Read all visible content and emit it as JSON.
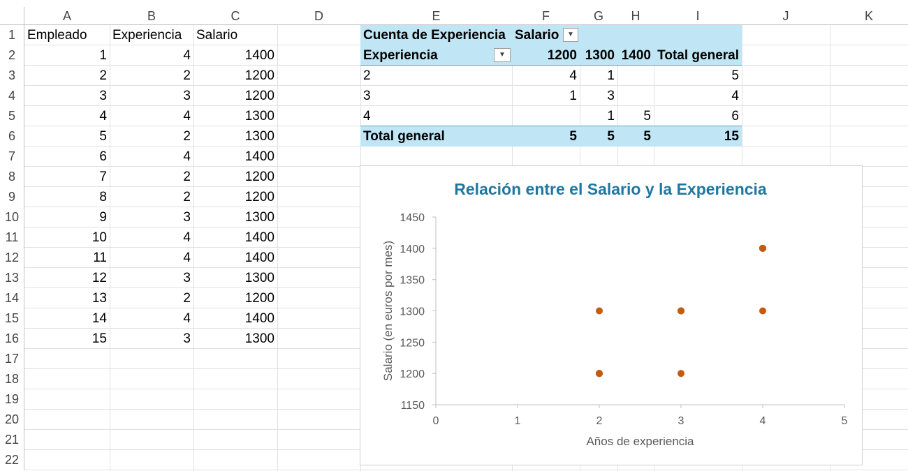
{
  "columns": [
    "A",
    "B",
    "C",
    "D",
    "E",
    "F",
    "G",
    "H",
    "I",
    "J",
    "K"
  ],
  "rows": [
    "1",
    "2",
    "3",
    "4",
    "5",
    "6",
    "7",
    "8",
    "9",
    "10",
    "11",
    "12",
    "13",
    "14",
    "15",
    "16",
    "17",
    "18",
    "19",
    "20",
    "21",
    "22"
  ],
  "table": {
    "headers": [
      "Empleado",
      "Experiencia",
      "Salario"
    ],
    "data": [
      [
        "1",
        "4",
        "1400"
      ],
      [
        "2",
        "2",
        "1200"
      ],
      [
        "3",
        "3",
        "1200"
      ],
      [
        "4",
        "4",
        "1300"
      ],
      [
        "5",
        "2",
        "1300"
      ],
      [
        "6",
        "4",
        "1400"
      ],
      [
        "7",
        "2",
        "1200"
      ],
      [
        "8",
        "2",
        "1200"
      ],
      [
        "9",
        "3",
        "1300"
      ],
      [
        "10",
        "4",
        "1400"
      ],
      [
        "11",
        "4",
        "1400"
      ],
      [
        "12",
        "3",
        "1300"
      ],
      [
        "13",
        "2",
        "1200"
      ],
      [
        "14",
        "4",
        "1400"
      ],
      [
        "15",
        "3",
        "1300"
      ]
    ]
  },
  "pivot": {
    "values_label": "Cuenta de Experiencia",
    "column_field": "Salario",
    "row_field": "Experiencia",
    "col_headers": [
      "1200",
      "1300",
      "1400",
      "Total general"
    ],
    "rows": [
      {
        "label": "2",
        "values": [
          "4",
          "1",
          "",
          "5"
        ]
      },
      {
        "label": "3",
        "values": [
          "1",
          "3",
          "",
          "4"
        ]
      },
      {
        "label": "4",
        "values": [
          "",
          "1",
          "5",
          "6"
        ]
      }
    ],
    "total": {
      "label": "Total general",
      "values": [
        "5",
        "5",
        "5",
        "15"
      ]
    }
  },
  "chart_data": {
    "type": "scatter",
    "title": "Relación entre el Salario y la Experiencia",
    "xlabel": "Años de experiencia",
    "ylabel": "Salario (en euros por mes)",
    "xlim": [
      0,
      5
    ],
    "ylim": [
      1150,
      1450
    ],
    "xticks": [
      0,
      1,
      2,
      3,
      4,
      5
    ],
    "yticks": [
      1150,
      1200,
      1250,
      1300,
      1350,
      1400,
      1450
    ],
    "grid": false,
    "color": "#c55a11",
    "title_color": "#1f77a0",
    "points": [
      {
        "x": 4,
        "y": 1400
      },
      {
        "x": 2,
        "y": 1200
      },
      {
        "x": 3,
        "y": 1200
      },
      {
        "x": 4,
        "y": 1300
      },
      {
        "x": 2,
        "y": 1300
      },
      {
        "x": 4,
        "y": 1400
      },
      {
        "x": 2,
        "y": 1200
      },
      {
        "x": 2,
        "y": 1200
      },
      {
        "x": 3,
        "y": 1300
      },
      {
        "x": 4,
        "y": 1400
      },
      {
        "x": 4,
        "y": 1400
      },
      {
        "x": 3,
        "y": 1300
      },
      {
        "x": 2,
        "y": 1200
      },
      {
        "x": 4,
        "y": 1400
      },
      {
        "x": 3,
        "y": 1300
      }
    ]
  }
}
